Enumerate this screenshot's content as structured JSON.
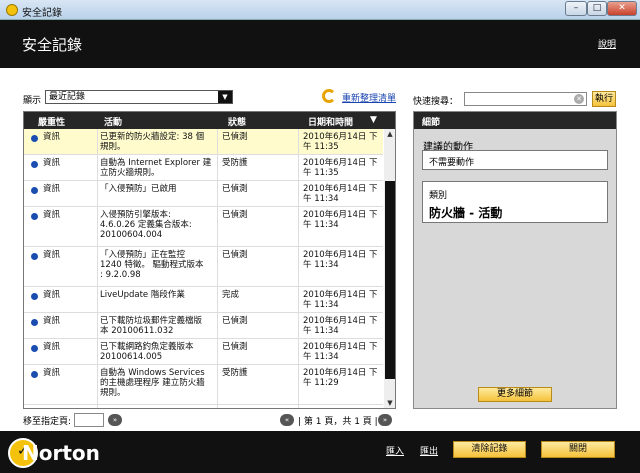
{
  "window": {
    "title": "安全記錄",
    "min": "–",
    "max": "□",
    "close": "✕"
  },
  "header": {
    "title": "安全記錄",
    "help": "說明"
  },
  "filter": {
    "label": "顯示",
    "selected": "最近記錄",
    "refresh": "重新整理清單"
  },
  "search": {
    "label": "快速搜尋：",
    "value": "",
    "go": "執行"
  },
  "table": {
    "columns": [
      "嚴重性",
      "活動",
      "狀態",
      "日期和時間"
    ],
    "rows": [
      {
        "severity": "資訊",
        "activity": "已更新的防火牆設定: 38 個\n規則。",
        "status": "已偵測",
        "datetime": "2010年6月14日 下\n午 11:35",
        "selected": true
      },
      {
        "severity": "資訊",
        "activity": "自動為 Internet Explorer 建\n立防火牆規則。",
        "status": "受防護",
        "datetime": "2010年6月14日 下\n午 11:35"
      },
      {
        "severity": "資訊",
        "activity": "「入侵預防」已啟用",
        "status": "已偵測",
        "datetime": "2010年6月14日 下\n午 11:34"
      },
      {
        "severity": "資訊",
        "activity": "入侵預防引擎版本:\n4.6.0.26 定義集合版本:\n20100604.004",
        "status": "已偵測",
        "datetime": "2010年6月14日 下\n午 11:34"
      },
      {
        "severity": "資訊",
        "activity": "「入侵預防」正在監控\n1240 特徵。 驅動程式版本\n: 9.2.0.98",
        "status": "已偵測",
        "datetime": "2010年6月14日 下\n午 11:34"
      },
      {
        "severity": "資訊",
        "activity": "LiveUpdate 階段作業",
        "status": "完成",
        "datetime": "2010年6月14日 下\n午 11:34"
      },
      {
        "severity": "資訊",
        "activity": "已下載防垃圾郵件定義檔版\n本 20100611.032",
        "status": "已偵測",
        "datetime": "2010年6月14日 下\n午 11:34"
      },
      {
        "severity": "資訊",
        "activity": "已下載網路釣魚定義版本\n20100614.005",
        "status": "已偵測",
        "datetime": "2010年6月14日 下\n午 11:34"
      },
      {
        "severity": "資訊",
        "activity": "自動為 Windows Services\n的主機處理程序 建立防火牆\n規則。",
        "status": "受防護",
        "datetime": "2010年6月14日 下\n午 11:29"
      }
    ]
  },
  "pager": {
    "jump_label": "移至指定頁:",
    "page_info": "| 第 1 頁，共 1 頁 |",
    "prev": "«",
    "next": "»",
    "go": "»"
  },
  "details": {
    "title": "細節",
    "recommended_label": "建議的動作",
    "recommended_value": "不需要動作",
    "category_label": "類別",
    "category_value": "防火牆 - 活動",
    "more": "更多細節"
  },
  "footer": {
    "logo": "Norton",
    "import": "匯入",
    "export": "匯出",
    "clear": "清除記錄",
    "close": "關閉"
  },
  "colors": {
    "accent": "#f5c23a",
    "dark": "#111111",
    "link": "#1a45b0",
    "info_dot": "#1b4db0"
  }
}
